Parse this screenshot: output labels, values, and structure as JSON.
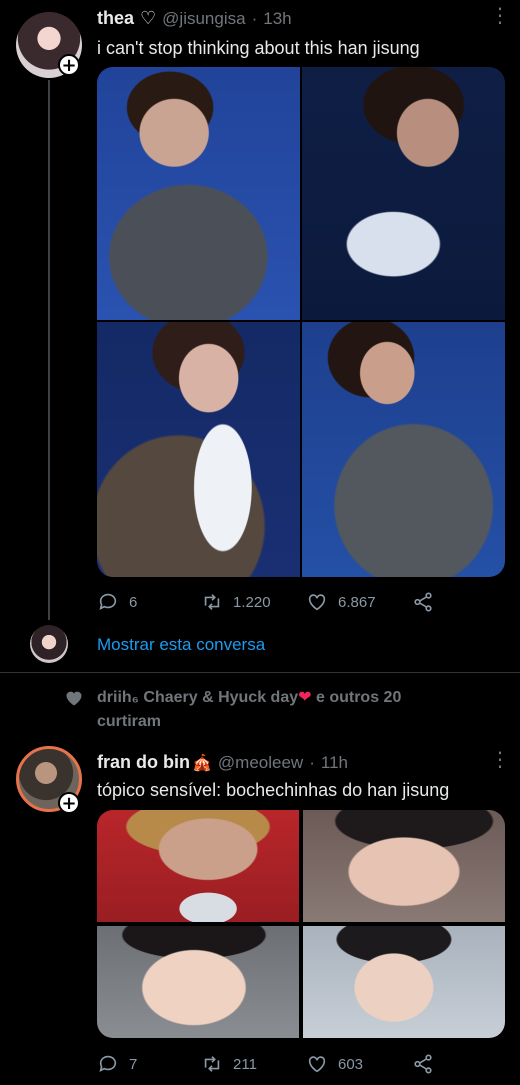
{
  "tweet1": {
    "name": "thea",
    "heart_glyph": "♡",
    "handle": "@jisungisa",
    "sep": "·",
    "time": "13h",
    "text": "i can't stop thinking about this han jisung",
    "replies": "6",
    "retweets": "1.220",
    "likes": "6.867"
  },
  "thread": {
    "show_conversation": "Mostrar esta conversa"
  },
  "social_context": {
    "text_before": "driih",
    "subscript": "₆",
    "text_middle": " Chaery & Hyuck day",
    "heart_emoji": "❤",
    "text_after": " e outros 20",
    "line2": "curtiram"
  },
  "tweet2": {
    "name": "fran do bin",
    "name_emoji": "🎪",
    "handle": "@meoleew",
    "sep": "·",
    "time": "11h",
    "text": "tópico sensível: bochechinhas do han jisung",
    "replies": "7",
    "retweets": "211",
    "likes": "603"
  },
  "colors": {
    "background": "#000000",
    "link": "#1d9bf0",
    "muted": "#71767b",
    "divider": "#2f3336"
  }
}
